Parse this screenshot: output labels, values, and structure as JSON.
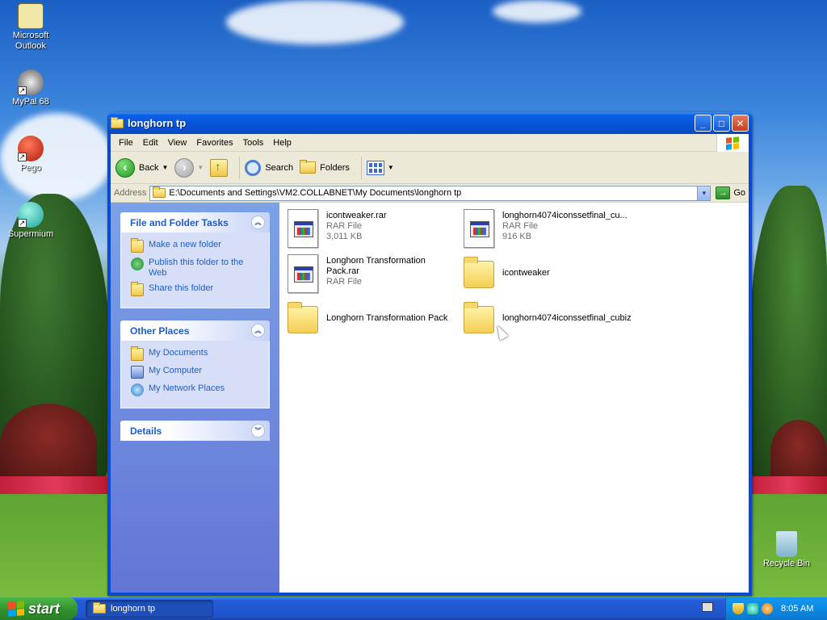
{
  "desktop": {
    "icons": [
      {
        "label": "Microsoft Outlook"
      },
      {
        "label": "MyPal 68"
      },
      {
        "label": "Pego"
      },
      {
        "label": "Supermium"
      },
      {
        "label": "Recycle Bin"
      }
    ]
  },
  "window": {
    "title": "longhorn tp",
    "buttons": {
      "minimize": "_",
      "maximize": "□",
      "close": "✕"
    },
    "menu": [
      "File",
      "Edit",
      "View",
      "Favorites",
      "Tools",
      "Help"
    ],
    "toolbar": {
      "back": "Back",
      "search": "Search",
      "folders": "Folders"
    },
    "address": {
      "label": "Address",
      "value": "E:\\Documents and Settings\\VM2.COLLABNET\\My Documents\\longhorn tp",
      "go": "Go"
    },
    "taskpane": {
      "file_tasks": {
        "title": "File and Folder Tasks",
        "items": [
          "Make a new folder",
          "Publish this folder to the Web",
          "Share this folder"
        ]
      },
      "other_places": {
        "title": "Other Places",
        "items": [
          "My Documents",
          "My Computer",
          "My Network Places"
        ]
      },
      "details": {
        "title": "Details"
      }
    },
    "files": [
      {
        "name": "icontweaker.rar",
        "type": "RAR File",
        "size": "3,011 KB",
        "kind": "rar"
      },
      {
        "name": "longhorn4074iconssetfinal_cu...",
        "type": "RAR File",
        "size": "916 KB",
        "kind": "rar"
      },
      {
        "name": "Longhorn Transformation Pack.rar",
        "type": "RAR File",
        "size": "",
        "kind": "rar"
      },
      {
        "name": "icontweaker",
        "type": "",
        "size": "",
        "kind": "folder"
      },
      {
        "name": "Longhorn Transformation Pack",
        "type": "",
        "size": "",
        "kind": "folder"
      },
      {
        "name": "longhorn4074iconssetfinal_cubiz",
        "type": "",
        "size": "",
        "kind": "folder"
      }
    ]
  },
  "taskbar": {
    "start": "start",
    "task": "longhorn tp",
    "clock": "8:05 AM"
  },
  "colors": {
    "title_blue": "#0a48d8",
    "link_blue": "#215dc6",
    "start_green": "#2f8f2b"
  }
}
